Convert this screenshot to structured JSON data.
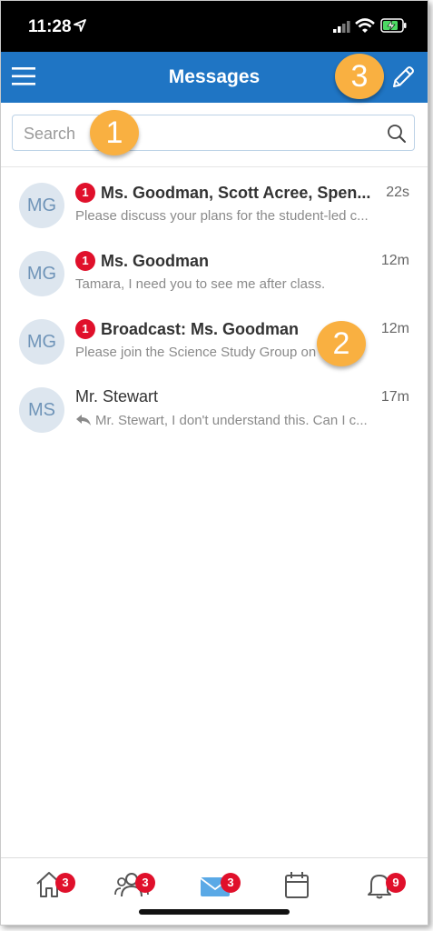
{
  "status_bar": {
    "time": "11:28"
  },
  "header": {
    "title": "Messages"
  },
  "search": {
    "placeholder": "Search"
  },
  "messages": [
    {
      "initials": "MG",
      "unread": "1",
      "name": "Ms. Goodman, Scott Acree, Spen...",
      "time": "22s",
      "preview": "Please discuss your plans for the student-led c..."
    },
    {
      "initials": "MG",
      "unread": "1",
      "name": "Ms. Goodman",
      "time": "12m",
      "preview": "Tamara, I need you to see me after class."
    },
    {
      "initials": "MG",
      "unread": "1",
      "name": "Broadcast: Ms. Goodman",
      "time": "12m",
      "preview": "Please join the Science Study Group on E..."
    },
    {
      "initials": "MS",
      "unread": "",
      "name": "Mr. Stewart",
      "time": "17m",
      "preview": "Mr. Stewart, I don't understand this. Can I c..."
    }
  ],
  "callouts": [
    "1",
    "2",
    "3"
  ],
  "tabs": [
    {
      "icon": "home-icon",
      "badge": "3"
    },
    {
      "icon": "people-icon",
      "badge": "3"
    },
    {
      "icon": "mail-icon",
      "badge": "3"
    },
    {
      "icon": "calendar-icon",
      "badge": ""
    },
    {
      "icon": "bell-icon",
      "badge": "9"
    }
  ],
  "colors": {
    "header": "#1f75c4",
    "badge": "#e0102b",
    "callout": "#f9b041",
    "active_tab": "#2e8ad8"
  }
}
